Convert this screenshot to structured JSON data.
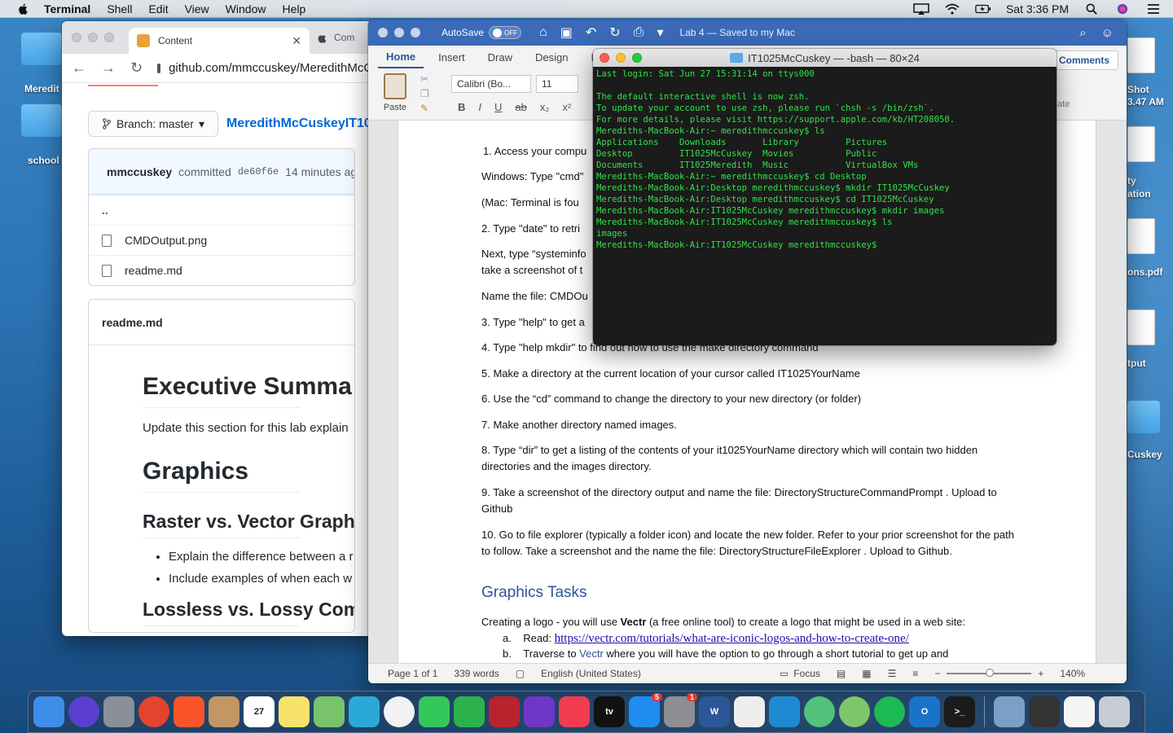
{
  "menubar": {
    "app_name": "Terminal",
    "items": [
      "Shell",
      "Edit",
      "View",
      "Window",
      "Help"
    ],
    "clock": "Sat 3:36 PM"
  },
  "desktop": {
    "icons": [
      {
        "label": "Meredit"
      },
      {
        "label": "school"
      },
      {
        "label": "Shot"
      },
      {
        "label": "3.47 AM"
      },
      {
        "label": "ty"
      },
      {
        "label": "ation"
      },
      {
        "label": "ons.pdf"
      },
      {
        "label": "tput"
      },
      {
        "label": "Cuskey"
      }
    ]
  },
  "browser": {
    "tab_title": "Content",
    "tab2_title": "Com",
    "url": "github.com/mmccuskey/MeredithMcC",
    "branch_label": "Branch: master",
    "repo_link": "MeredithMcCuskeyIT10",
    "commit": {
      "author": "mmccuskey",
      "text": "committed",
      "sha": "de60f6e",
      "time": "14 minutes ago"
    },
    "files": [
      "..",
      "CMDOutput.png",
      "readme.md"
    ],
    "readme_title": "readme.md",
    "readme": {
      "h1_exec": "Executive Summa",
      "p_exec": "Update this section for this lab explain",
      "h1_graphics": "Graphics",
      "h2_raster": "Raster vs. Vector Graph",
      "bullets": [
        "Explain the difference between a r",
        "Include examples of when each w"
      ],
      "h2_lossless": "Lossless vs. Lossy Com"
    }
  },
  "word": {
    "autosave_label": "AutoSave",
    "toggle_label": "OFF",
    "doc_title": "Lab 4 — Saved to my Mac",
    "tabs": [
      "Home",
      "Insert",
      "Draw",
      "Design",
      "Lay"
    ],
    "comments_label": "Comments",
    "paste_label": "Paste",
    "font_name": "Calibri (Bo...",
    "font_size": "11",
    "format_buttons": [
      "B",
      "I",
      "U",
      "ab",
      "x₂",
      "x²"
    ],
    "ribbon_right": "ate",
    "doc_lines": [
      "1. Access your compu",
      "Windows: Type \"cmd\"",
      "(Mac:  Terminal is fou",
      "2. Type \"date\" to retri",
      "Next, type “systeminfo",
      "take a screenshot of t",
      "Name the file: CMDOu",
      "3. Type \"help\" to get a",
      "4. Type \"help mkdir\" to find out how to use the make directory command",
      "5. Make a directory at the current location of your cursor called IT1025YourName",
      " 6. Use the “cd” command to change the directory to your new directory (or folder)",
      " 7. Make another directory named images.",
      " 8. Type “dir” to get a listing of the contents of your it1025YourName directory which will contain two hidden directories and the images directory.",
      " 9. Take a screenshot of the directory output and name the file: DirectoryStructureCommandPrompt . Upload to Github",
      "10. Go to file explorer (typically a folder icon) and locate the new folder. Refer to your prior screenshot for the path to follow. Take a screenshot and the name the file: DirectoryStructureFileExplorer . Upload to Github."
    ],
    "graphics_heading": "Graphics Tasks",
    "graphics_intro_pre": "Creating a logo - you will use ",
    "graphics_intro_bold": "Vectr",
    "graphics_intro_post": " (a free online tool) to create a logo that might be used in a web site:",
    "item_a_label": "a.",
    "item_a_text": "Read:",
    "item_a_link": "https://vectr.com/tutorials/what-are-iconic-logos-and-how-to-create-one/",
    "item_b_label": "b.",
    "item_b_pre": "Traverse to ",
    "item_b_link": "Vectr",
    "item_b_post": " where you will have the option to go through a short tutorial to get up and",
    "status": {
      "page": "Page 1 of 1",
      "words": "339 words",
      "language": "English (United States)",
      "focus": "Focus",
      "zoom": "140%"
    }
  },
  "terminal": {
    "title": "IT1025McCuskey — -bash — 80×24",
    "lines": [
      "Last login: Sat Jun 27 15:31:14 on ttys000",
      "",
      "The default interactive shell is now zsh.",
      "To update your account to use zsh, please run `chsh -s /bin/zsh`.",
      "For more details, please visit https://support.apple.com/kb/HT208050.",
      "Merediths-MacBook-Air:~ meredithmccuskey$ ls",
      "Applications    Downloads       Library         Pictures",
      "Desktop         IT1025McCuskey  Movies          Public",
      "Documents       IT1025Meredith  Music           VirtualBox VMs",
      "Merediths-MacBook-Air:~ meredithmccuskey$ cd Desktop",
      "Merediths-MacBook-Air:Desktop meredithmccuskey$ mkdir IT1025McCuskey",
      "Merediths-MacBook-Air:Desktop meredithmccuskey$ cd IT1025McCuskey",
      "Merediths-MacBook-Air:IT1025McCuskey meredithmccuskey$ mkdir images",
      "Merediths-MacBook-Air:IT1025McCuskey meredithmccuskey$ ls",
      "images",
      "Merediths-MacBook-Air:IT1025McCuskey meredithmccuskey$"
    ]
  },
  "dock": {
    "items": [
      {
        "name": "finder",
        "color": "#3d8ee8"
      },
      {
        "name": "siri",
        "color": "#5b3fd0"
      },
      {
        "name": "launchpad",
        "color": "#8a8f99"
      },
      {
        "name": "chrome",
        "color": "#e4432d"
      },
      {
        "name": "brave",
        "color": "#fb542b"
      },
      {
        "name": "contacts",
        "color": "#c39763"
      },
      {
        "name": "calendar",
        "color": "#ffffff",
        "text": "27"
      },
      {
        "name": "notes",
        "color": "#f7e26b"
      },
      {
        "name": "maps",
        "color": "#79c36a"
      },
      {
        "name": "kindle",
        "color": "#2aa9d8"
      },
      {
        "name": "photos",
        "color": "#f2f2f2"
      },
      {
        "name": "messages",
        "color": "#34c759"
      },
      {
        "name": "facetime",
        "color": "#2bb24c"
      },
      {
        "name": "photo-booth",
        "color": "#b9232e"
      },
      {
        "name": "imovie",
        "color": "#6f36c8"
      },
      {
        "name": "news",
        "color": "#f23c4f"
      },
      {
        "name": "tv",
        "color": "#111111",
        "text": "tv"
      },
      {
        "name": "app-store",
        "color": "#1e8cf0",
        "badge": "5"
      },
      {
        "name": "system-preferences",
        "color": "#8e8e93",
        "badge": "1"
      },
      {
        "name": "word",
        "color": "#2b5797",
        "text": "W"
      },
      {
        "name": "textedit",
        "color": "#eeeeee"
      },
      {
        "name": "vscode",
        "color": "#1f8ad2"
      },
      {
        "name": "atom",
        "color": "#52c27b"
      },
      {
        "name": "color-picker",
        "color": "#7fc66a"
      },
      {
        "name": "spotify",
        "color": "#1db954"
      },
      {
        "name": "outlook",
        "color": "#1a73c8",
        "text": "O"
      },
      {
        "name": "terminal",
        "color": "#1b1b1b",
        "text": ">_"
      },
      {
        "name": "preview",
        "color": "#7aa0c8"
      },
      {
        "name": "screenshot",
        "color": "#333333"
      },
      {
        "name": "document",
        "color": "#f5f5f5"
      },
      {
        "name": "trash",
        "color": "#c7ccd2"
      }
    ]
  }
}
